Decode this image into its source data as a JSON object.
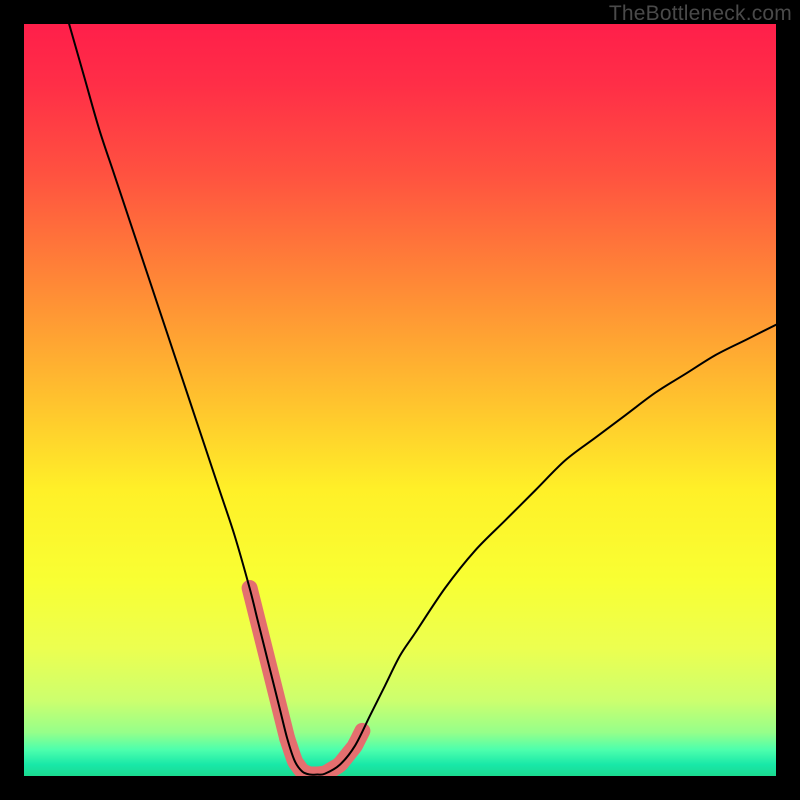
{
  "watermark": "TheBottleneck.com",
  "gradient": {
    "stops": [
      {
        "offset": 0.0,
        "color": "#ff1f4a"
      },
      {
        "offset": 0.08,
        "color": "#ff2e47"
      },
      {
        "offset": 0.2,
        "color": "#ff5240"
      },
      {
        "offset": 0.35,
        "color": "#ff8a36"
      },
      {
        "offset": 0.5,
        "color": "#ffc22e"
      },
      {
        "offset": 0.62,
        "color": "#fff028"
      },
      {
        "offset": 0.74,
        "color": "#f8ff33"
      },
      {
        "offset": 0.83,
        "color": "#ecff50"
      },
      {
        "offset": 0.9,
        "color": "#ccff6e"
      },
      {
        "offset": 0.942,
        "color": "#96ff8a"
      },
      {
        "offset": 0.965,
        "color": "#4dffad"
      },
      {
        "offset": 0.985,
        "color": "#18e8a8"
      },
      {
        "offset": 1.0,
        "color": "#1bd98f"
      }
    ]
  },
  "chart_data": {
    "type": "line",
    "title": "",
    "xlabel": "",
    "ylabel": "",
    "xlim": [
      0,
      100
    ],
    "ylim": [
      0,
      100
    ],
    "series": [
      {
        "name": "main-curve",
        "stroke": "#000000",
        "width": 2.0,
        "x": [
          6,
          8,
          10,
          12,
          14,
          16,
          18,
          20,
          22,
          24,
          26,
          28,
          30,
          31,
          32,
          33,
          34,
          35,
          36,
          37,
          38,
          39,
          40,
          42,
          44,
          46,
          48,
          50,
          52,
          56,
          60,
          64,
          68,
          72,
          76,
          80,
          84,
          88,
          92,
          96,
          100
        ],
        "y": [
          100,
          93,
          86,
          80,
          74,
          68,
          62,
          56,
          50,
          44,
          38,
          32,
          25,
          21,
          17,
          13,
          9,
          5,
          2,
          0.6,
          0.2,
          0.2,
          0.3,
          1.5,
          4,
          8,
          12,
          16,
          19,
          25,
          30,
          34,
          38,
          42,
          45,
          48,
          51,
          53.5,
          56,
          58,
          60
        ]
      }
    ],
    "highlight_segments": {
      "comment": "pink thick overlay near trough",
      "stroke": "#e46f6f",
      "width": 16,
      "ranges_x": [
        [
          30,
          35
        ],
        [
          35,
          40
        ],
        [
          40,
          45
        ]
      ]
    }
  }
}
